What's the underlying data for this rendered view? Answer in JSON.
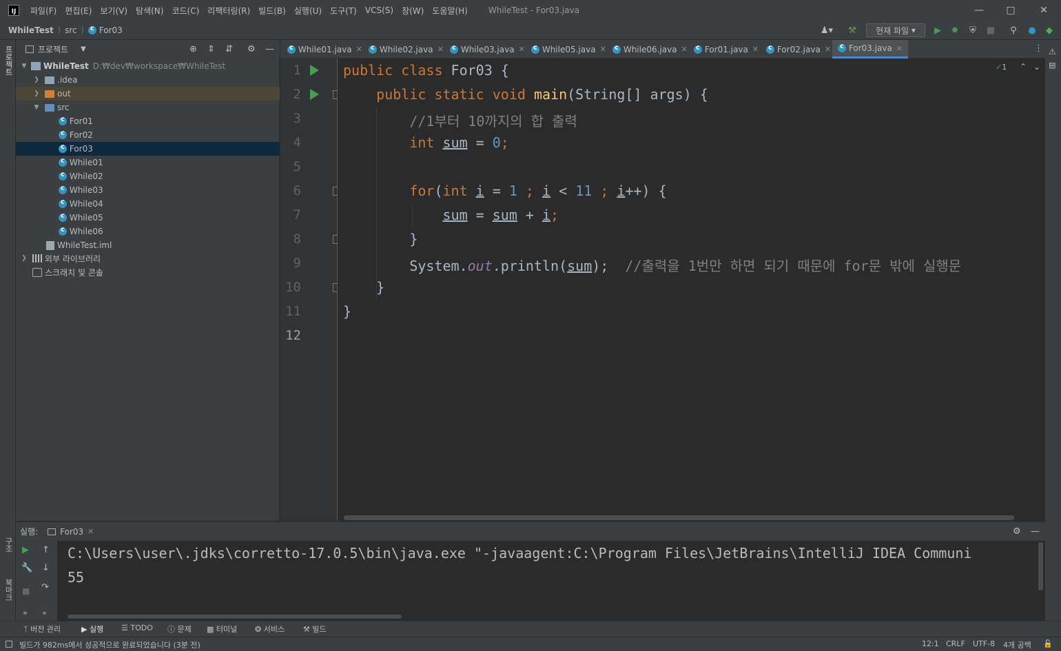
{
  "window": {
    "title": "WhileTest - For03.java",
    "menu": [
      "파일(F)",
      "편집(E)",
      "보기(V)",
      "탐색(N)",
      "코드(C)",
      "리팩터링(R)",
      "빌드(B)",
      "실행(U)",
      "도구(T)",
      "VCS(S)",
      "창(W)",
      "도움말(H)"
    ]
  },
  "breadcrumb": [
    "WhileTest",
    "src",
    "For03"
  ],
  "toolbar": {
    "run_config": "현재 파일"
  },
  "project_panel": {
    "title": "프로젝트",
    "root_name": "WhileTest",
    "root_path": "D:₩dev₩workspace₩WhileTest",
    "items": [
      {
        "label": ".idea"
      },
      {
        "label": "out"
      },
      {
        "label": "src"
      },
      {
        "label": "For01"
      },
      {
        "label": "For02"
      },
      {
        "label": "For03"
      },
      {
        "label": "While01"
      },
      {
        "label": "While02"
      },
      {
        "label": "While03"
      },
      {
        "label": "While04"
      },
      {
        "label": "While05"
      },
      {
        "label": "While06"
      },
      {
        "label": "WhileTest.iml"
      },
      {
        "label": "외부 라이브러리"
      },
      {
        "label": "스크래치 및 콘솔"
      }
    ]
  },
  "left_strip": {
    "project": "프로젝트",
    "structure": "구조",
    "bookmarks": "북마크"
  },
  "tabs": [
    "While01.java",
    "While02.java",
    "While03.java",
    "While05.java",
    "While06.java",
    "For01.java",
    "For02.java",
    "For03.java"
  ],
  "editor": {
    "problems_count": "1",
    "line_numbers": [
      "1",
      "2",
      "3",
      "4",
      "5",
      "6",
      "7",
      "8",
      "9",
      "10",
      "11",
      "12"
    ],
    "code": {
      "l1_a": "public class ",
      "l1_b": "For03 {",
      "l2_a": "    public static void ",
      "l2_fn": "main",
      "l2_b": "(String[] args) {",
      "l3": "        //1부터 10까지의 합 출력",
      "l4_kw": "        int ",
      "l4_var": "sum",
      "l4_eq": " = ",
      "l4_num": "0",
      "l4_semi": ";",
      "l6_for": "        for",
      "l6_p": "(",
      "l6_int": "int ",
      "l6_i1": "i",
      "l6_eq": " = ",
      "l6_n1": "1",
      "l6_s1": " ; ",
      "l6_i2": "i",
      "l6_lt": " < ",
      "l6_n2": "11",
      "l6_s2": " ; ",
      "l6_i3": "i",
      "l6_rest": "++) {",
      "l7_ind": "            ",
      "l7_v1": "sum",
      "l7_eq": " = ",
      "l7_v2": "sum",
      "l7_plus": " + ",
      "l7_v3": "i",
      "l7_semi": ";",
      "l8": "        }",
      "l9_a": "        System.",
      "l9_out": "out",
      "l9_b": ".println(",
      "l9_sum": "sum",
      "l9_c": ");",
      "l9_cm": "  //출력을 1번만 하면 되기 때문에 for문 밖에 실행문",
      "l10": "    }",
      "l11": "}"
    }
  },
  "run_panel": {
    "label": "실행:",
    "tab": "For03",
    "console": [
      "C:\\Users\\user\\.jdks\\corretto-17.0.5\\bin\\java.exe \"-javaagent:C:\\Program Files\\JetBrains\\IntelliJ IDEA Communi",
      "55"
    ]
  },
  "bottom_tools": [
    "버전 관리",
    "실행",
    "TODO",
    "문제",
    "터미널",
    "서비스",
    "빌드"
  ],
  "status": {
    "message": "빌드가 982ms에서 성공적으로 완료되었습니다 (3분 전)",
    "position": "12:1",
    "line_ending": "CRLF",
    "encoding": "UTF-8",
    "indent": "4개 공백"
  },
  "colors": {
    "accent": "#4a88c7",
    "selection": "#0d293e",
    "run_green": "#499c54",
    "keyword": "#cc7832",
    "number": "#6897bb"
  }
}
